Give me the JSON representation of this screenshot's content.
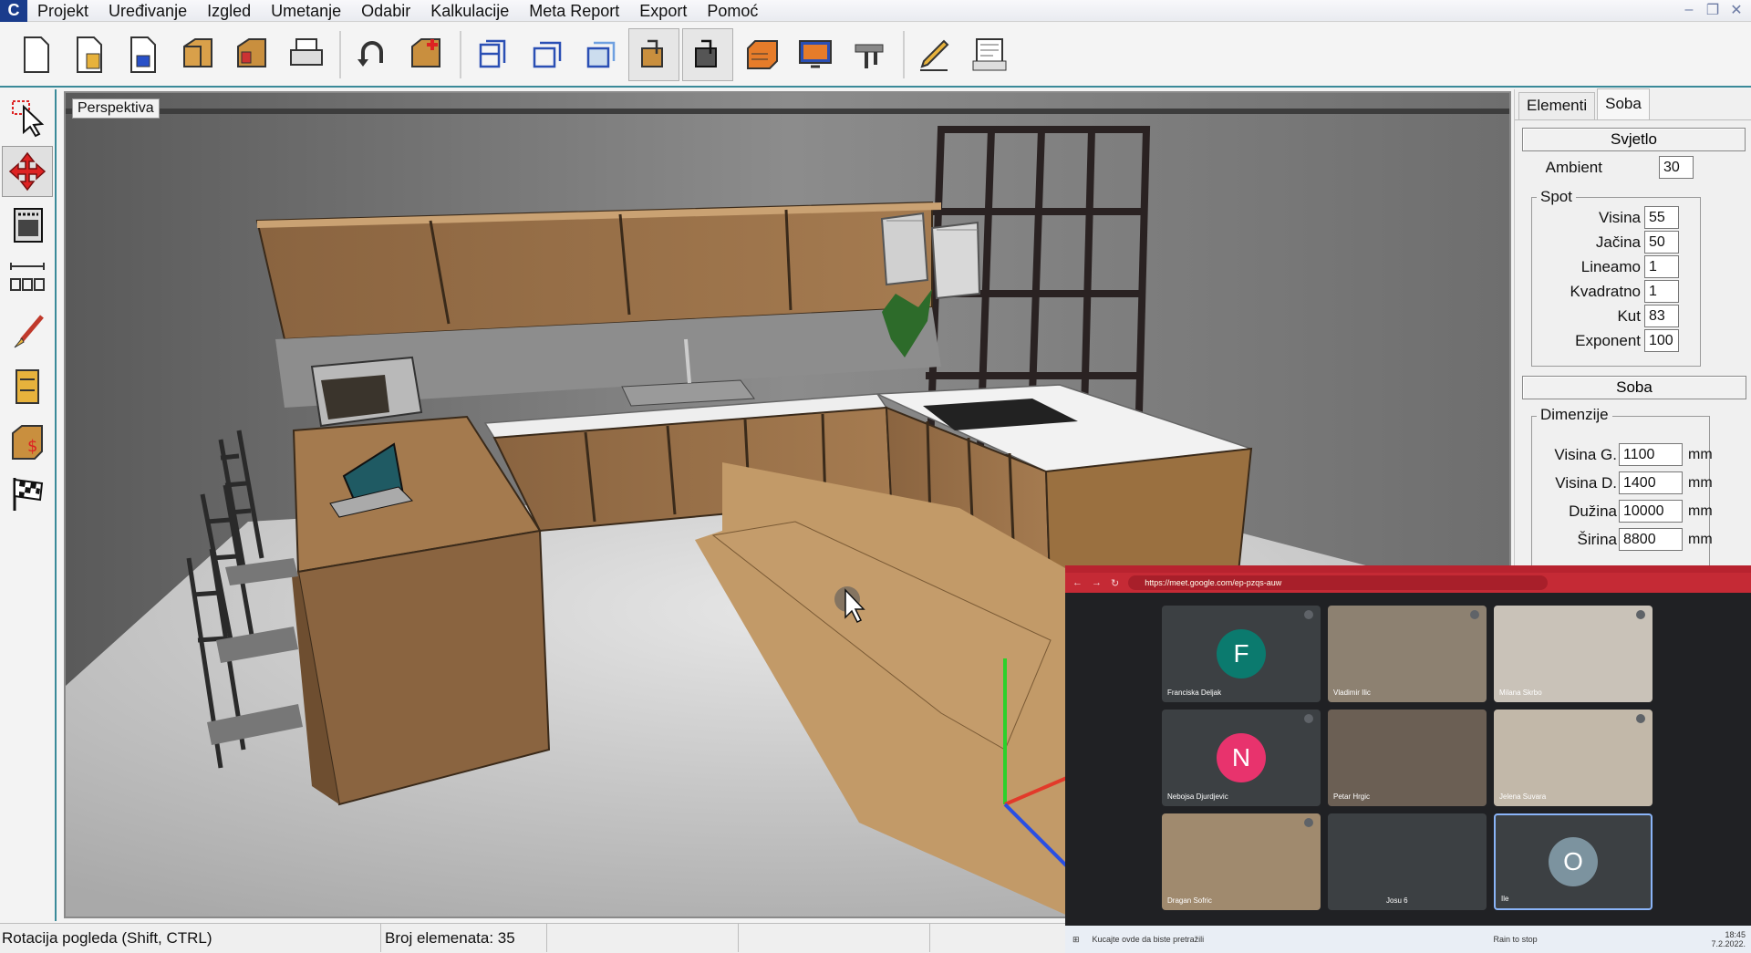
{
  "app": {
    "logo_letter": "C"
  },
  "menu": [
    "Projekt",
    "Uređivanje",
    "Izgled",
    "Umetanje",
    "Odabir",
    "Kalkulacije",
    "Meta Report",
    "Export",
    "Pomoć"
  ],
  "window_controls": [
    "–",
    "❐",
    "✕"
  ],
  "toolbar": {
    "icons": [
      "new-file-icon",
      "open-file-icon",
      "save-file-icon",
      "cabinet-icon",
      "cabinet-open-icon",
      "printer-icon",
      "undo-icon",
      "add-element-icon",
      "view-front-icon",
      "view-side-icon",
      "view-top-icon",
      "view-perspective-icon",
      "view-iso-icon",
      "drawer-icon",
      "render-icon",
      "render-monitor-icon",
      "tools-icon",
      "edit-pen-icon",
      "report-icon"
    ]
  },
  "left_tools": [
    "select-arrow-icon",
    "rotate-move-icon",
    "oven-icon",
    "dimension-icon",
    "paint-brush-icon",
    "drawer-list-icon",
    "price-box-icon",
    "finish-flag-icon"
  ],
  "viewport": {
    "label": "Perspektiva"
  },
  "panel": {
    "tabs": [
      "Elementi",
      "Soba"
    ],
    "active_tab": "Soba",
    "svjetlo": {
      "title": "Svjetlo",
      "ambient_label": "Ambient",
      "ambient": "30",
      "spot_group": "Spot",
      "visina_label": "Visina",
      "visina": "55",
      "jacina_label": "Jačina",
      "jacina": "50",
      "lineamo_label": "Lineamo",
      "lineamo": "1",
      "kvadratno_label": "Kvadratno",
      "kvadratno": "1",
      "kut_label": "Kut",
      "kut": "83",
      "exponent_label": "Exponent",
      "exponent": "100"
    },
    "soba": {
      "title": "Soba",
      "dim_group": "Dimenzije",
      "visina_g_label": "Visina G.",
      "visina_g": "1100",
      "visina_d_label": "Visina D.",
      "visina_d": "1400",
      "duzina_label": "Dužina",
      "duzina": "10000",
      "sirina_label": "Širina",
      "sirina": "8800",
      "unit": "mm"
    }
  },
  "status": {
    "hint": "Rotacija pogleda (Shift, CTRL)",
    "count": "Broj elemenata: 35"
  },
  "meet": {
    "url": "https://meet.google.com/ep-pzqs-auw",
    "participants": [
      {
        "name": "Franciska Deljak",
        "initial": "F",
        "color": "#0b7a6e"
      },
      {
        "name": "Vladimir Ilic",
        "initial": "",
        "color": "#8d8171"
      },
      {
        "name": "Milana Skrbo",
        "initial": "",
        "color": "#c9c2b8"
      },
      {
        "name": "Nebojsa Djurdjevic",
        "initial": "N",
        "color": "#e8336d"
      },
      {
        "name": "Petar Hrgic",
        "initial": "",
        "color": "#6b5f54"
      },
      {
        "name": "Jelena Suvara",
        "initial": "",
        "color": "#c2b8a9"
      },
      {
        "name": "Dragan Sofric",
        "initial": "",
        "color": "#a08a6e"
      },
      {
        "name": "Josu 6",
        "initial": "",
        "color": "#3c4043"
      },
      {
        "name": "Ile",
        "initial": "O",
        "color": "#7c939f"
      }
    ],
    "taskbar_search": "Kucajte ovde da biste pretražili",
    "weather": "Rain to stop",
    "time": "18:45",
    "date": "7.2.2022."
  }
}
